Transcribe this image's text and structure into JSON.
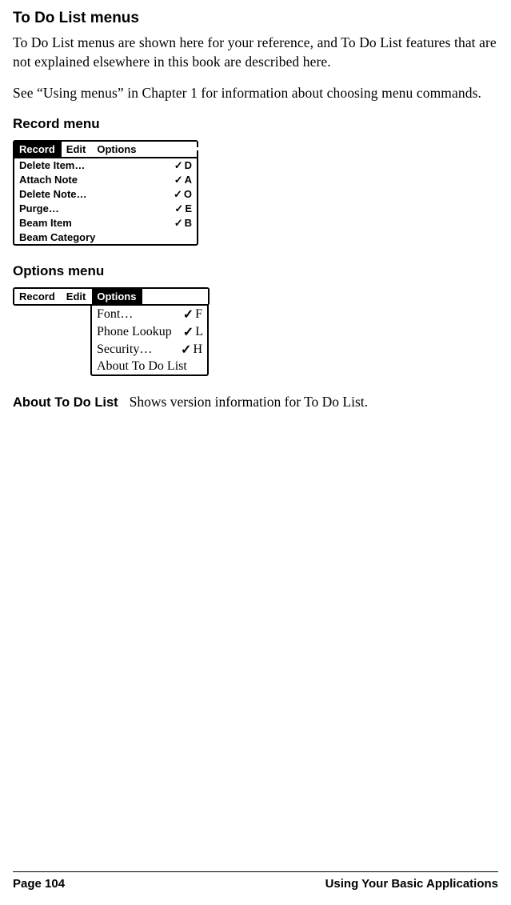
{
  "headings": {
    "main": "To Do List menus",
    "record": "Record menu",
    "options": "Options menu"
  },
  "paragraphs": {
    "p1": "To Do List menus are shown here for your reference, and To Do List features that are not explained elsewhere in this book are described here.",
    "p2": "See “Using menus” in Chapter 1 for information about choosing menu commands."
  },
  "menu_record": {
    "bar": {
      "record": "Record",
      "edit": "Edit",
      "options": "Options"
    },
    "items": [
      {
        "label": "Delete Item…",
        "shortcut": "D"
      },
      {
        "label": "Attach Note",
        "shortcut": "A"
      },
      {
        "label": "Delete Note…",
        "shortcut": "O"
      },
      {
        "label": "Purge…",
        "shortcut": "E"
      },
      {
        "label": "Beam Item",
        "shortcut": "B"
      },
      {
        "label": "Beam Category",
        "shortcut": ""
      }
    ]
  },
  "menu_options": {
    "bar": {
      "record": "Record",
      "edit": "Edit",
      "options": "Options"
    },
    "items": [
      {
        "label": "Font…",
        "shortcut": "F"
      },
      {
        "label": "Phone Lookup",
        "shortcut": "L"
      },
      {
        "label": "Security…",
        "shortcut": "H"
      },
      {
        "label": "About To Do List",
        "shortcut": ""
      }
    ]
  },
  "description": {
    "label": "About To Do List",
    "text": "Shows version information for To Do List."
  },
  "footer": {
    "left": "Page 104",
    "right": "Using Your Basic Applications"
  }
}
